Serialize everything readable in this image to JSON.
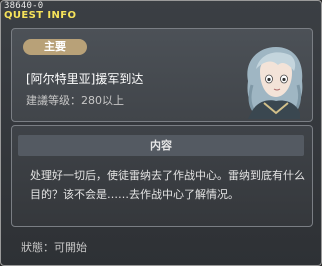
{
  "window": {
    "id": "38640-0",
    "title": "QUEST INFO"
  },
  "quest": {
    "category": "主要",
    "title": "[阿尔特里亚]援军到达",
    "level_requirement": "建議等级：280以上"
  },
  "content": {
    "header": "内容",
    "description": "处理好一切后，使徒雷纳去了作战中心。雷纳到底有什么目的？该不会是……去作战中心了解情况。"
  },
  "status": {
    "label": "狀態：可開始"
  }
}
